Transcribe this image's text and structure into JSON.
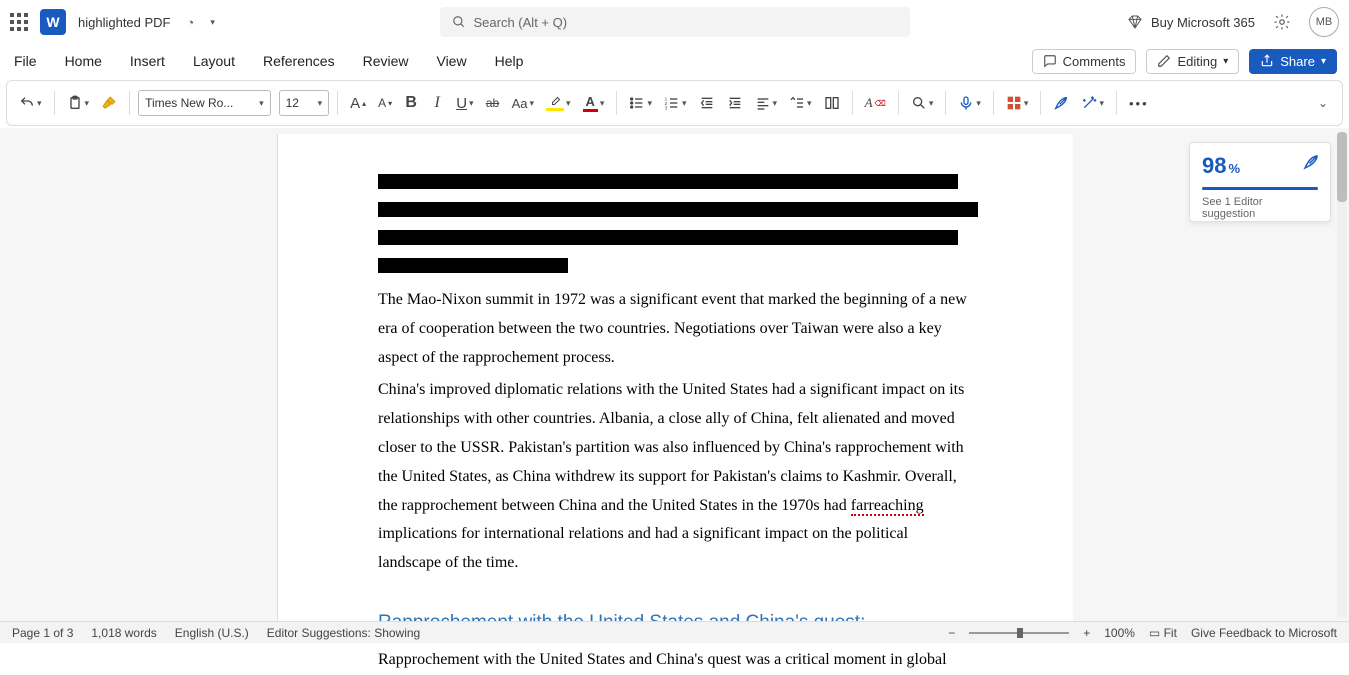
{
  "title": {
    "doc_name": "highlighted PDF"
  },
  "search": {
    "placeholder": "Search (Alt + Q)"
  },
  "header_right": {
    "buy_label": "Buy Microsoft 365",
    "avatar_initials": "MB"
  },
  "tabs": {
    "file": "File",
    "home": "Home",
    "insert": "Insert",
    "layout": "Layout",
    "references": "References",
    "review": "Review",
    "view": "View",
    "help": "Help"
  },
  "tab_buttons": {
    "comments": "Comments",
    "editing": "Editing",
    "share": "Share"
  },
  "ribbon": {
    "font_name": "Times New Ro...",
    "font_size": "12",
    "case_label": "Aa",
    "strike_label": "ab"
  },
  "document": {
    "p1": "The Mao-Nixon summit in 1972 was a significant event that marked the beginning of a new era of cooperation between the two countries. Negotiations over Taiwan were also a key aspect of the rapprochement process.",
    "p2a": "China's improved diplomatic relations with the United States had a significant impact on its relationships with other countries. Albania, a close ally of China, felt alienated and moved closer to the USSR. Pakistan's partition was also influenced by China's rapprochement with the United States, as China withdrew its support for Pakistan's claims to Kashmir. Overall, the rapprochement between China and the United States in the 1970s had ",
    "p2err": "farreaching",
    "p2b": " implications for international relations and had a significant impact on the political landscape of the time.",
    "h2": "Rapprochement with the United States and China's quest:",
    "p3": "Rapprochement with the United States and China's quest was a critical moment in global"
  },
  "editor": {
    "score": "98",
    "pct": "%",
    "hint": "See 1 Editor suggestion"
  },
  "status": {
    "page": "Page 1 of 3",
    "words": "1,018 words",
    "lang": "English (U.S.)",
    "suggestions": "Editor Suggestions: Showing",
    "zoom": "100%",
    "fit": "Fit",
    "feedback": "Give Feedback to Microsoft"
  }
}
